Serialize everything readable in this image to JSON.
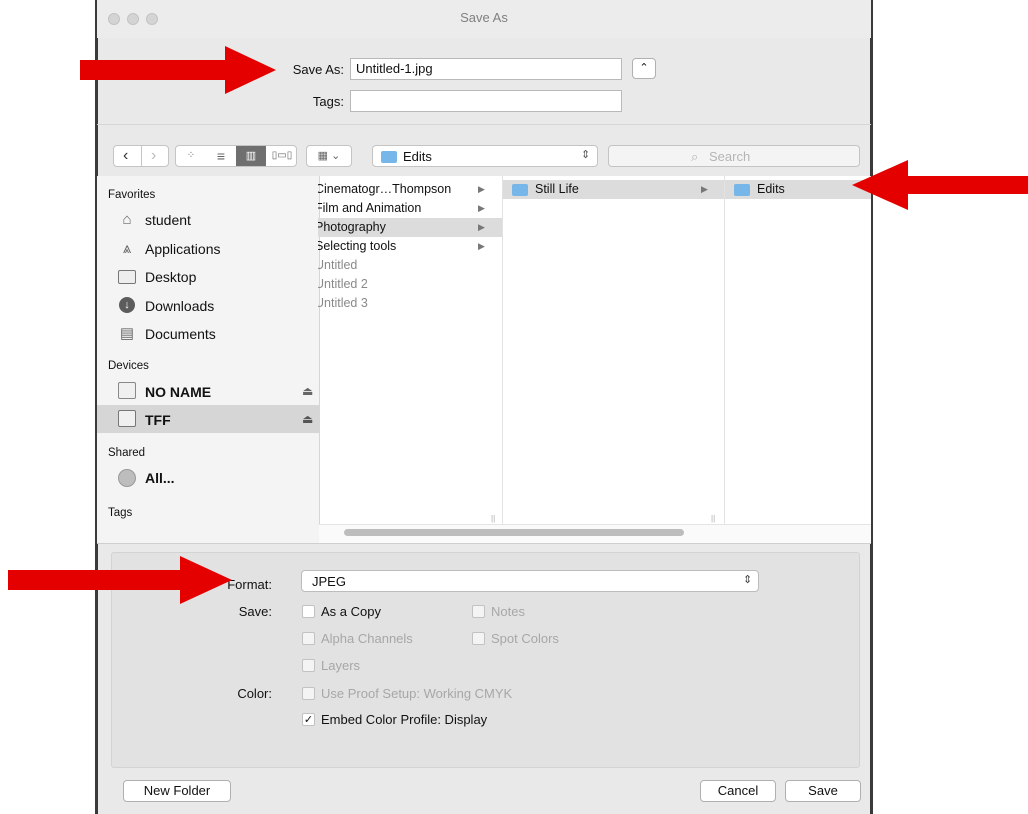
{
  "window": {
    "title": "Save As"
  },
  "save_as": {
    "label": "Save As:",
    "value": "Untitled-1.jpg",
    "tags_label": "Tags:",
    "tags_value": ""
  },
  "toolbar": {
    "location": "Edits",
    "search_placeholder": "Search"
  },
  "sidebar": {
    "favorites_header": "Favorites",
    "favorites": [
      {
        "label": "student",
        "icon": "home-icon"
      },
      {
        "label": "Applications",
        "icon": "applications-icon"
      },
      {
        "label": "Desktop",
        "icon": "desktop-icon"
      },
      {
        "label": "Downloads",
        "icon": "downloads-icon"
      },
      {
        "label": "Documents",
        "icon": "documents-icon"
      }
    ],
    "devices_header": "Devices",
    "devices": [
      {
        "label": "NO NAME",
        "icon": "drive-icon"
      },
      {
        "label": "TFF",
        "icon": "drive-icon"
      }
    ],
    "shared_header": "Shared",
    "shared": [
      {
        "label": "All...",
        "icon": "network-icon"
      }
    ],
    "tags_header": "Tags"
  },
  "columns": {
    "col1": [
      "Cinematogr…Thompson",
      "Film and Animation",
      "Photography",
      "Selecting tools",
      "Untitled",
      "Untitled 2",
      "Untitled 3"
    ],
    "col2": [
      "Still Life"
    ],
    "col3": [
      "Edits"
    ]
  },
  "format": {
    "label": "Format:",
    "value": "JPEG"
  },
  "save_options": {
    "label": "Save:",
    "as_copy": "As a Copy",
    "notes": "Notes",
    "alpha": "Alpha Channels",
    "spot": "Spot Colors",
    "layers": "Layers"
  },
  "color_options": {
    "label": "Color:",
    "proof": "Use Proof Setup:  Working CMYK",
    "embed": "Embed Color Profile:  Display",
    "embed_checked": true
  },
  "buttons": {
    "new_folder": "New Folder",
    "cancel": "Cancel",
    "save": "Save"
  },
  "colors": {
    "arrow": "#e50000",
    "folder": "#76b6e8"
  }
}
